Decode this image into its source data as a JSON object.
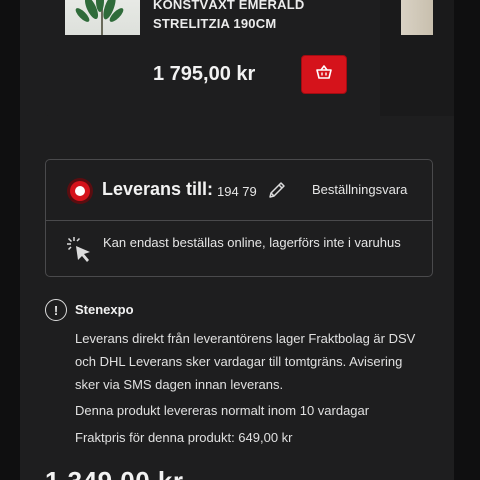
{
  "product": {
    "name": "KONSTVÄXT EMERALD STRELITZIA 190CM",
    "price": "1 795,00 kr",
    "add_to_cart_icon": "basket-icon"
  },
  "delivery": {
    "title": "Leverans till:",
    "zip": "194 79",
    "order_type": "Beställningsvara",
    "online_only": "Kan endast beställas online, lagerförs inte i varuhus",
    "accent": "#d5131b"
  },
  "supplier": {
    "name": "Stenexpo",
    "text1": "Leverans direkt från leverantörens lager Fraktbolag är DSV och DHL Leverans sker vardagar till tomtgräns. Avisering sker via SMS dagen innan leverans.",
    "text2": "Denna produkt levereras normalt inom 10 vardagar",
    "text3": "Fraktpris för denna produkt: 649,00 kr"
  },
  "bottom_price": "1 349,00 kr"
}
